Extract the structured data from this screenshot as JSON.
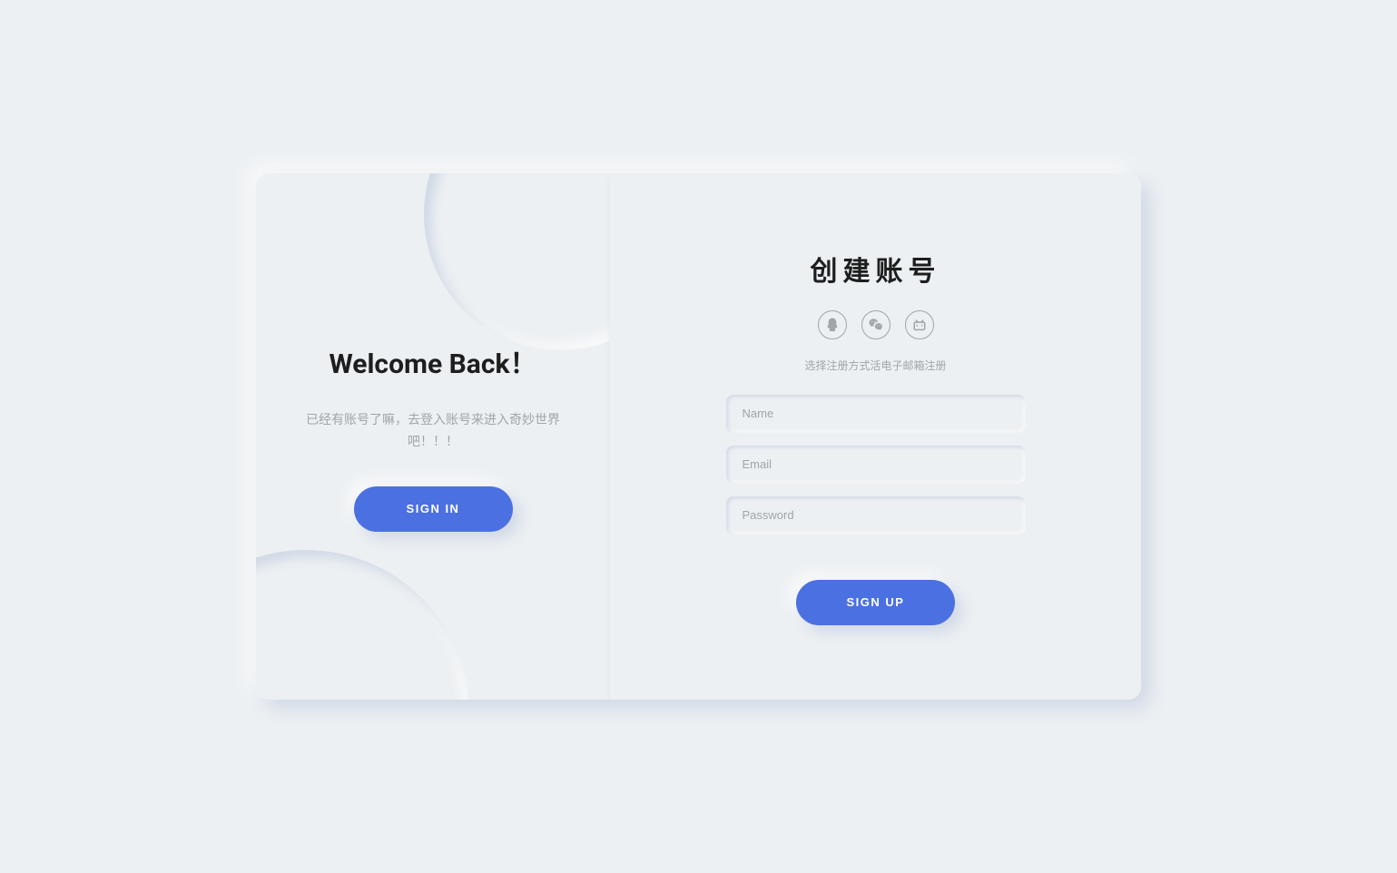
{
  "left": {
    "title": "Welcome Back！",
    "desc": "已经有账号了嘛，去登入账号来进入奇妙世界吧！！！",
    "button": "SIGN IN"
  },
  "right": {
    "title": "创建账号",
    "hint": "选择注册方式活电子邮箱注册",
    "name_placeholder": "Name",
    "email_placeholder": "Email",
    "password_placeholder": "Password",
    "button": "SIGN UP"
  },
  "social": {
    "qq": "qq",
    "wechat": "wechat",
    "bilibili": "bilibili"
  }
}
